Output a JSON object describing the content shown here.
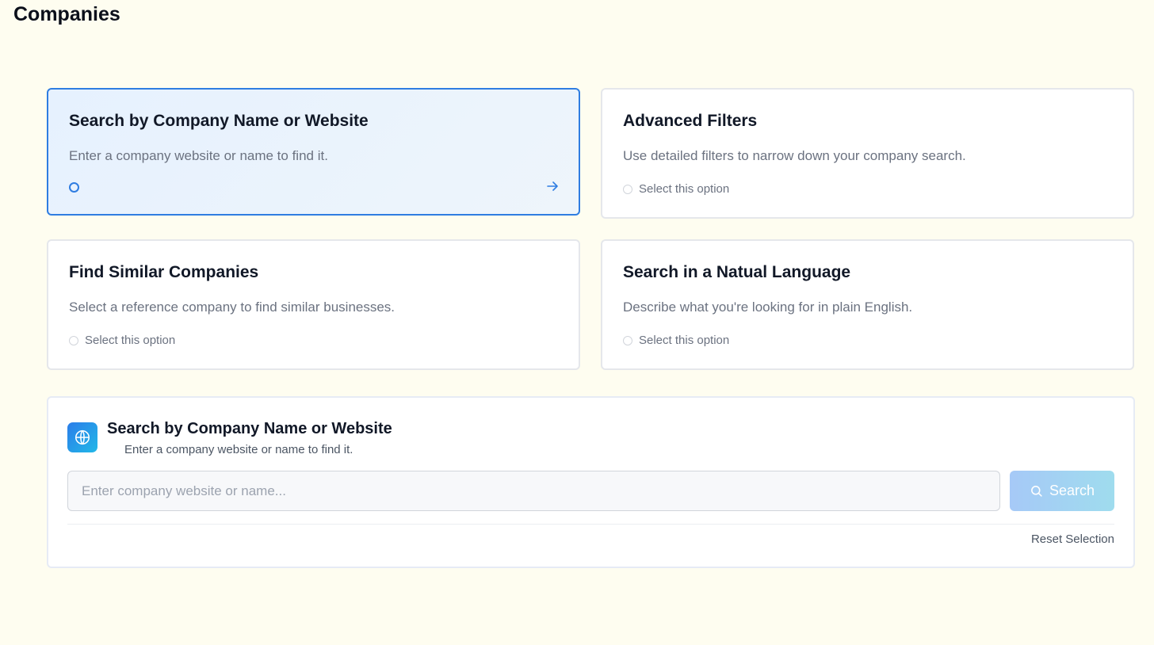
{
  "page": {
    "title": "Companies"
  },
  "options": [
    {
      "title": "Search by Company Name or Website",
      "description": "Enter a company website or name to find it.",
      "footer": "",
      "selected": true
    },
    {
      "title": "Advanced Filters",
      "description": "Use detailed filters to narrow down your company search.",
      "footer": "Select this option",
      "selected": false
    },
    {
      "title": "Find Similar Companies",
      "description": "Select a reference company to find similar businesses.",
      "footer": "Select this option",
      "selected": false
    },
    {
      "title": "Search in a Natual Language",
      "description": "Describe what you're looking for in plain English.",
      "footer": "Select this option",
      "selected": false
    }
  ],
  "panel": {
    "icon": "globe-icon",
    "title": "Search by Company Name or Website",
    "subtitle": "Enter a company website or name to find it.",
    "input": {
      "value": "",
      "placeholder": "Enter company website or name..."
    },
    "search_label": "Search",
    "reset_label": "Reset Selection"
  },
  "colors": {
    "accent": "#2f7de1",
    "background": "#fefdf0",
    "selected_card_bg": "#e6f1fe"
  }
}
